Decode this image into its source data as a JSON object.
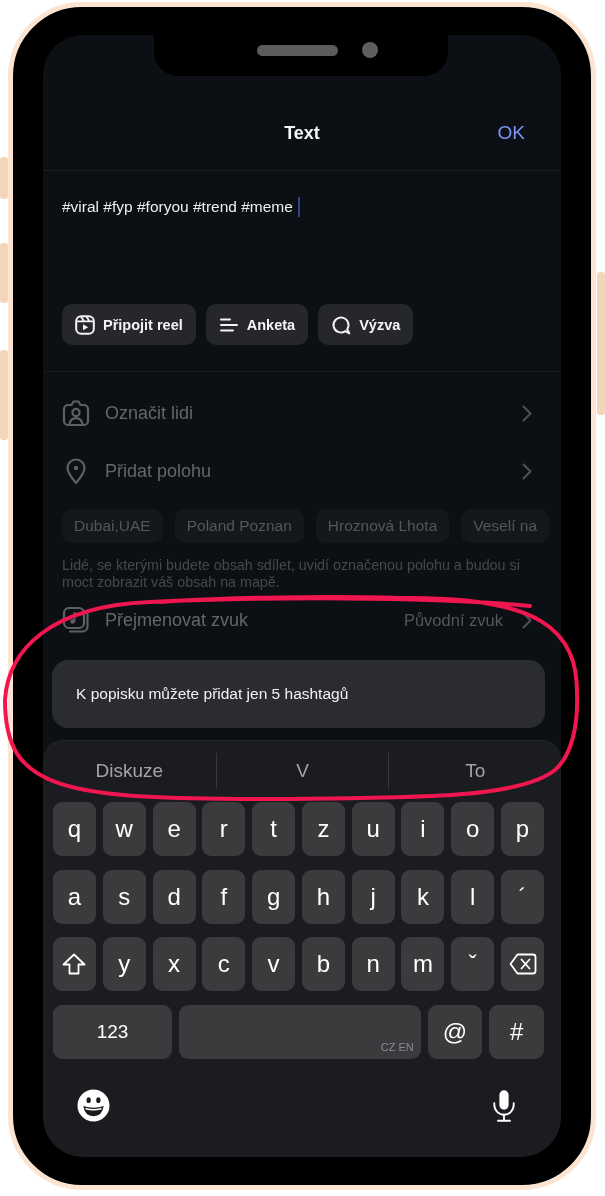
{
  "header": {
    "title": "Text",
    "action": "OK"
  },
  "caption": {
    "value": "#viral #fyp #foryou #trend #meme"
  },
  "attachments": [
    {
      "kind": "reel",
      "label": "Připojit reel"
    },
    {
      "kind": "poll",
      "label": "Anketa"
    },
    {
      "kind": "prompt",
      "label": "Výzva"
    }
  ],
  "options": [
    {
      "kind": "tag",
      "label": "Označit lidi"
    },
    {
      "kind": "location",
      "label": "Přidat polohu",
      "suggestions": [
        "Dubai,UAE",
        "Poland Poznan",
        "Hroznová Lhota",
        "Veselí na"
      ],
      "note": "Lidé, se kterými budete obsah sdílet, uvidí označenou polohu a budou si moct zobrazit váš obsah na mapě."
    },
    {
      "kind": "sound",
      "label": "Přejmenovat zvuk",
      "value": "Původní zvuk"
    }
  ],
  "toast": {
    "message": "K popisku můžete přidat jen 5 hashtagů"
  },
  "keyboard": {
    "suggestions": [
      "Diskuze",
      "V",
      "To"
    ],
    "rows": [
      [
        {
          "kind": "char",
          "label": "q"
        },
        {
          "kind": "char",
          "label": "w"
        },
        {
          "kind": "char",
          "label": "e"
        },
        {
          "kind": "char",
          "label": "r"
        },
        {
          "kind": "char",
          "label": "t"
        },
        {
          "kind": "char",
          "label": "z"
        },
        {
          "kind": "char",
          "label": "u"
        },
        {
          "kind": "char",
          "label": "i"
        },
        {
          "kind": "char",
          "label": "o"
        },
        {
          "kind": "char",
          "label": "p"
        }
      ],
      [
        {
          "kind": "char",
          "label": "a"
        },
        {
          "kind": "char",
          "label": "s"
        },
        {
          "kind": "char",
          "label": "d"
        },
        {
          "kind": "char",
          "label": "f"
        },
        {
          "kind": "char",
          "label": "g"
        },
        {
          "kind": "char",
          "label": "h"
        },
        {
          "kind": "char",
          "label": "j"
        },
        {
          "kind": "char",
          "label": "k"
        },
        {
          "kind": "char",
          "label": "l"
        },
        {
          "kind": "char",
          "label": "´"
        }
      ],
      [
        {
          "kind": "shift"
        },
        {
          "kind": "char",
          "label": "y"
        },
        {
          "kind": "char",
          "label": "x"
        },
        {
          "kind": "char",
          "label": "c"
        },
        {
          "kind": "char",
          "label": "v"
        },
        {
          "kind": "char",
          "label": "b"
        },
        {
          "kind": "char",
          "label": "n"
        },
        {
          "kind": "char",
          "label": "m"
        },
        {
          "kind": "char",
          "label": "ˇ"
        },
        {
          "kind": "backspace"
        }
      ]
    ],
    "bottom_row": [
      {
        "kind": "mode",
        "label": "123"
      },
      {
        "kind": "space",
        "label": "CZ EN"
      },
      {
        "kind": "char",
        "label": "@"
      },
      {
        "kind": "char",
        "label": "#"
      }
    ]
  }
}
